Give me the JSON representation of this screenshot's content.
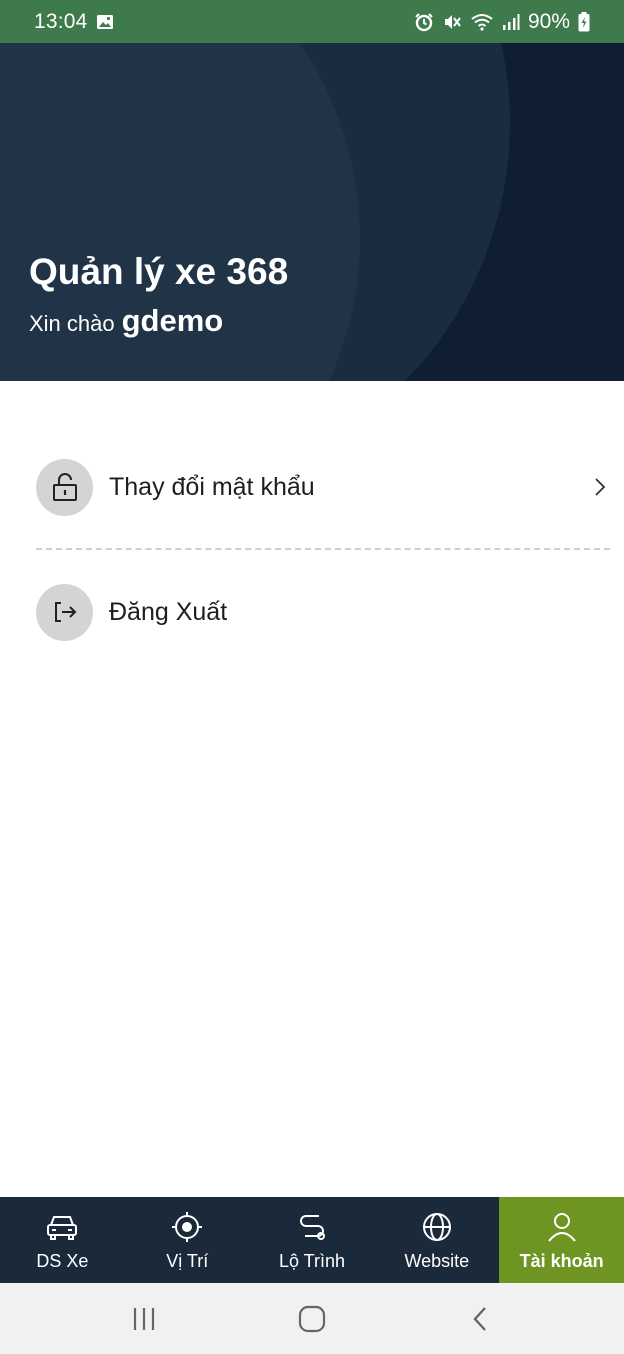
{
  "status_bar": {
    "time": "13:04",
    "battery": "90%",
    "icons": [
      "image-icon",
      "alarm-icon",
      "mute-icon",
      "wifi-icon",
      "signal-icon",
      "battery-charging-icon"
    ]
  },
  "header": {
    "title": "Quản lý xe 368",
    "greeting_prefix": "Xin chào",
    "username": "gdemo"
  },
  "menu": {
    "items": [
      {
        "label": "Thay đổi mật khẩu",
        "icon": "unlock-icon"
      },
      {
        "label": "Đăng Xuất",
        "icon": "logout-icon"
      }
    ]
  },
  "bottom_nav": {
    "items": [
      {
        "label": "DS Xe",
        "icon": "car-icon"
      },
      {
        "label": "Vị Trí",
        "icon": "target-icon"
      },
      {
        "label": "Lộ Trình",
        "icon": "route-icon"
      },
      {
        "label": "Website",
        "icon": "globe-icon"
      },
      {
        "label": "Tài khoản",
        "icon": "user-icon",
        "active": true
      }
    ]
  },
  "colors": {
    "status_bar": "#3f7a4c",
    "header_bg": "#0f1e30",
    "nav_bg": "#1b2a3b",
    "nav_active": "#6e9521",
    "icon_circle": "#d4d4d4"
  }
}
